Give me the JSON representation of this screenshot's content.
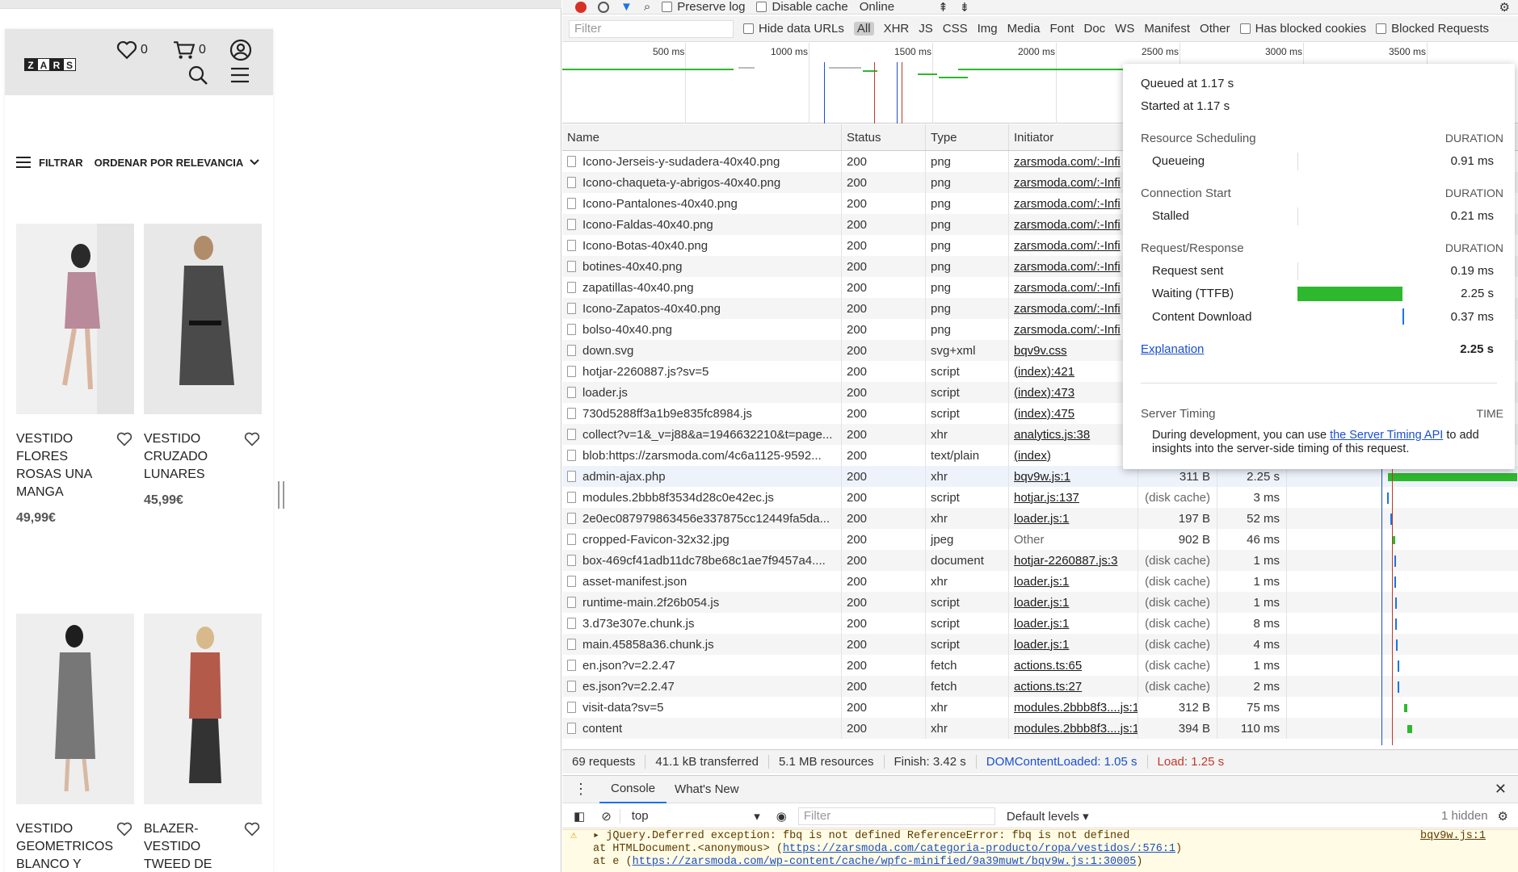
{
  "page": {
    "cart": {
      "wish_count": "0",
      "cart_count": "0"
    },
    "logo_letters": [
      "Z",
      "A",
      "R",
      "S"
    ],
    "filter_label": "FILTRAR",
    "sort_label": "ORDENAR POR RELEVANCIA",
    "products": [
      {
        "name": "VESTIDO FLORES ROSAS UNA MANGA",
        "price": "49,99€"
      },
      {
        "name": "VESTIDO CRUZADO LUNARES",
        "price": "45,99€"
      },
      {
        "name": "VESTIDO GEOMETRICOS BLANCO Y",
        "price": ""
      },
      {
        "name": "BLAZER-VESTIDO TWEED DE",
        "price": ""
      }
    ]
  },
  "devtools": {
    "toolbar1": {
      "preserve_log": "Preserve log",
      "disable_cache": "Disable cache",
      "throttle": "Online"
    },
    "toolbar2": {
      "filter_placeholder": "Filter",
      "hide_data_urls": "Hide data URLs",
      "types": [
        "All",
        "XHR",
        "JS",
        "CSS",
        "Img",
        "Media",
        "Font",
        "Doc",
        "WS",
        "Manifest",
        "Other"
      ],
      "has_blocked_cookies": "Has blocked cookies",
      "blocked_requests": "Blocked Requests"
    },
    "ticks": [
      "500 ms",
      "1000 ms",
      "1500 ms",
      "2000 ms",
      "2500 ms",
      "3000 ms",
      "3500 ms"
    ],
    "columns": {
      "name": "Name",
      "status": "Status",
      "type": "Type",
      "initiator": "Initiator"
    },
    "rows": [
      {
        "name": "Icono-Jerseis-y-sudadera-40x40.png",
        "status": "200",
        "type": "png",
        "initiator": "zarsmoda.com/:-Infi",
        "size": "",
        "time": ""
      },
      {
        "name": "Icono-chaqueta-y-abrigos-40x40.png",
        "status": "200",
        "type": "png",
        "initiator": "zarsmoda.com/:-Infi",
        "size": "",
        "time": ""
      },
      {
        "name": "Icono-Pantalones-40x40.png",
        "status": "200",
        "type": "png",
        "initiator": "zarsmoda.com/:-Infi",
        "size": "",
        "time": ""
      },
      {
        "name": "Icono-Faldas-40x40.png",
        "status": "200",
        "type": "png",
        "initiator": "zarsmoda.com/:-Infi",
        "size": "",
        "time": ""
      },
      {
        "name": "Icono-Botas-40x40.png",
        "status": "200",
        "type": "png",
        "initiator": "zarsmoda.com/:-Infi",
        "size": "",
        "time": ""
      },
      {
        "name": "botines-40x40.png",
        "status": "200",
        "type": "png",
        "initiator": "zarsmoda.com/:-Infi",
        "size": "",
        "time": ""
      },
      {
        "name": "zapatillas-40x40.png",
        "status": "200",
        "type": "png",
        "initiator": "zarsmoda.com/:-Infi",
        "size": "",
        "time": ""
      },
      {
        "name": "Icono-Zapatos-40x40.png",
        "status": "200",
        "type": "png",
        "initiator": "zarsmoda.com/:-Infi",
        "size": "",
        "time": ""
      },
      {
        "name": "bolso-40x40.png",
        "status": "200",
        "type": "png",
        "initiator": "zarsmoda.com/:-Infi",
        "size": "",
        "time": ""
      },
      {
        "name": "down.svg",
        "status": "200",
        "type": "svg+xml",
        "initiator": "bqv9v.css",
        "size": "",
        "time": ""
      },
      {
        "name": "hotjar-2260887.js?sv=5",
        "status": "200",
        "type": "script",
        "initiator": "(index):421",
        "size": "",
        "time": ""
      },
      {
        "name": "loader.js",
        "status": "200",
        "type": "script",
        "initiator": "(index):473",
        "size": "",
        "time": ""
      },
      {
        "name": "730d5288ff3a1b9e835fc8984.js",
        "status": "200",
        "type": "script",
        "initiator": "(index):475",
        "size": "",
        "time": ""
      },
      {
        "name": "collect?v=1&_v=j88&a=1946632210&t=page...",
        "status": "200",
        "type": "xhr",
        "initiator": "analytics.js:38",
        "size": "",
        "time": ""
      },
      {
        "name": "blob:https://zarsmoda.com/4c6a1125-9592...",
        "status": "200",
        "type": "text/plain",
        "initiator": "(index)",
        "size": "",
        "time": ""
      },
      {
        "name": "admin-ajax.php",
        "status": "200",
        "type": "xhr",
        "initiator": "bqv9w.js:1",
        "size": "311 B",
        "time": "2.25 s"
      },
      {
        "name": "modules.2bbb8f3534d28c0e42ec.js",
        "status": "200",
        "type": "script",
        "initiator": "hotjar.js:137",
        "size": "(disk cache)",
        "time": "3 ms"
      },
      {
        "name": "2e0ec087979863456e337875cc12449fa5da...",
        "status": "200",
        "type": "xhr",
        "initiator": "loader.js:1",
        "size": "197 B",
        "time": "52 ms"
      },
      {
        "name": "cropped-Favicon-32x32.jpg",
        "status": "200",
        "type": "jpeg",
        "initiator": "Other",
        "size": "902 B",
        "time": "46 ms"
      },
      {
        "name": "box-469cf41adb11dc78be68c1ae7f9457a4....",
        "status": "200",
        "type": "document",
        "initiator": "hotjar-2260887.js:3",
        "size": "(disk cache)",
        "time": "1 ms"
      },
      {
        "name": "asset-manifest.json",
        "status": "200",
        "type": "xhr",
        "initiator": "loader.js:1",
        "size": "(disk cache)",
        "time": "1 ms"
      },
      {
        "name": "runtime-main.2f26b054.js",
        "status": "200",
        "type": "script",
        "initiator": "loader.js:1",
        "size": "(disk cache)",
        "time": "1 ms"
      },
      {
        "name": "3.d73e307e.chunk.js",
        "status": "200",
        "type": "script",
        "initiator": "loader.js:1",
        "size": "(disk cache)",
        "time": "8 ms"
      },
      {
        "name": "main.45858a36.chunk.js",
        "status": "200",
        "type": "script",
        "initiator": "loader.js:1",
        "size": "(disk cache)",
        "time": "4 ms"
      },
      {
        "name": "en.json?v=2.2.47",
        "status": "200",
        "type": "fetch",
        "initiator": "actions.ts:65",
        "size": "(disk cache)",
        "time": "1 ms"
      },
      {
        "name": "es.json?v=2.2.47",
        "status": "200",
        "type": "fetch",
        "initiator": "actions.ts:27",
        "size": "(disk cache)",
        "time": "2 ms"
      },
      {
        "name": "visit-data?sv=5",
        "status": "200",
        "type": "xhr",
        "initiator": "modules.2bbb8f3....js:1",
        "size": "312 B",
        "time": "75 ms"
      },
      {
        "name": "content",
        "status": "200",
        "type": "xhr",
        "initiator": "modules.2bbb8f3....js:1",
        "size": "394 B",
        "time": "110 ms"
      }
    ],
    "status_bar": {
      "requests": "69 requests",
      "transferred": "41.1 kB transferred",
      "resources": "5.1 MB resources",
      "finish": "Finish: 3.42 s",
      "dom": "DOMContentLoaded: 1.05 s",
      "load": "Load: 1.25 s"
    },
    "console_tabs": [
      "Console",
      "What's New"
    ],
    "console_toolbar": {
      "context": "top",
      "filter_placeholder": "Filter",
      "levels": "Default levels ▾",
      "hidden": "1 hidden"
    },
    "console_msg": {
      "line1": "▸ jQuery.Deferred exception: fbq is not defined ReferenceError: fbq is not defined",
      "source": "bqv9w.js:1",
      "line2_prefix": "    at HTMLDocument.<anonymous> (",
      "line2_link": "https://zarsmoda.com/categoria-producto/ropa/vestidos/:576:1",
      "line3_prefix": "    at e (",
      "line3_link": "https://zarsmoda.com/wp-content/cache/wpfc-minified/9a39muwt/bqv9w.js:1:30005"
    },
    "timing": {
      "queued": "Queued at 1.17 s",
      "started": "Started at 1.17 s",
      "sec1": "Resource Scheduling",
      "sec2": "Connection Start",
      "sec3": "Request/Response",
      "sec4": "Server Timing",
      "duration": "DURATION",
      "time": "TIME",
      "items": [
        {
          "label": "Queueing",
          "value": "0.91 ms"
        },
        {
          "label": "Stalled",
          "value": "0.21 ms"
        },
        {
          "label": "Request sent",
          "value": "0.19 ms"
        },
        {
          "label": "Waiting (TTFB)",
          "value": "2.25 s"
        },
        {
          "label": "Content Download",
          "value": "0.37 ms"
        }
      ],
      "explanation": "Explanation",
      "total": "2.25 s",
      "server_text_1": "During development, you can use ",
      "server_link": "the Server Timing API",
      "server_text_2": " to add insights into the server-side timing of this request."
    }
  }
}
